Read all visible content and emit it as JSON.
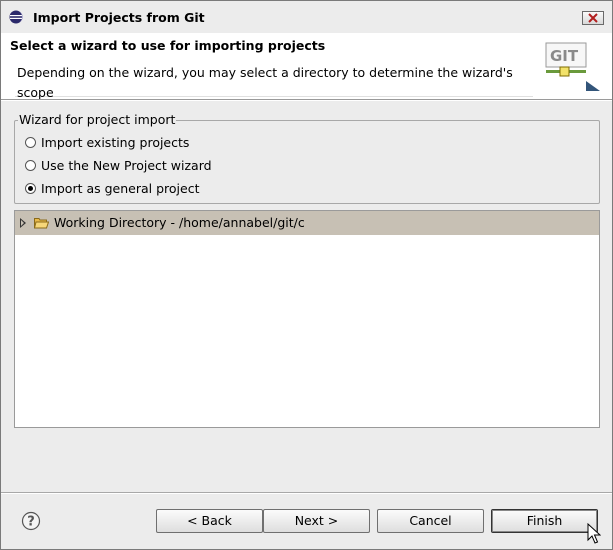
{
  "window": {
    "title": "Import Projects from Git"
  },
  "header": {
    "title": "Select a wizard to use for importing projects",
    "message": "Depending on the wizard, you may select a directory to determine the wizard's scope",
    "logo_text": "GIT"
  },
  "wizard_group": {
    "label": "Wizard for project import",
    "options": [
      {
        "label": "Import existing projects",
        "selected": false
      },
      {
        "label": "Use the New Project wizard",
        "selected": false
      },
      {
        "label": "Import as general project",
        "selected": true
      }
    ]
  },
  "tree": {
    "items": [
      {
        "label": "Working Directory - /home/annabel/git/c",
        "expanded": false,
        "icon": "folder-open-icon"
      }
    ]
  },
  "buttons": {
    "back": "< Back",
    "next": "Next >",
    "cancel": "Cancel",
    "finish": "Finish"
  },
  "colors": {
    "selection": "#c7c0b4",
    "background": "#ececec"
  }
}
